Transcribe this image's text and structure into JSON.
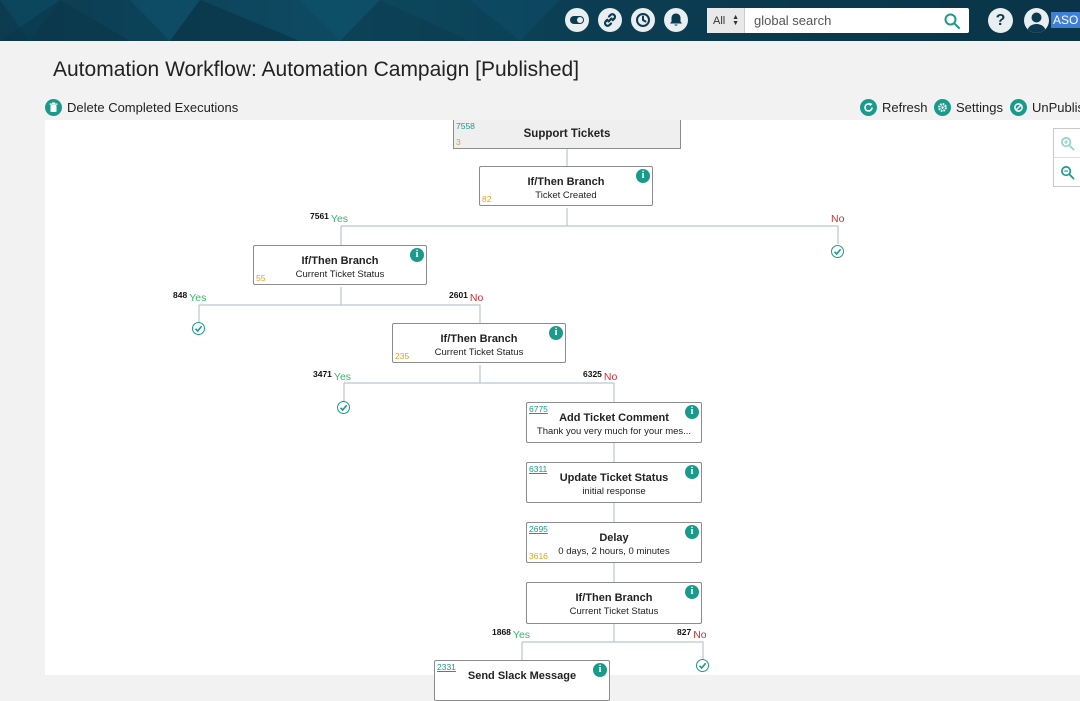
{
  "topbar": {
    "icons": [
      "toggle-icon",
      "link-icon",
      "history-icon",
      "bell-icon"
    ],
    "search": {
      "scope": "All",
      "placeholder": "global search"
    },
    "help": "?",
    "user_name": "ASO I"
  },
  "header": {
    "title": "Automation Workflow: Automation Campaign [Published]",
    "delete_label": "Delete Completed Executions",
    "refresh_label": "Refresh",
    "settings_label": "Settings",
    "unpublish_label": "UnPublis"
  },
  "workflow": {
    "trigger": {
      "title": "Support Tickets",
      "count_top": "7558",
      "count_bottom": "3"
    },
    "nodes": [
      {
        "title": "If/Then Branch",
        "subtitle": "Ticket Created",
        "count_top": "",
        "count_bottom": "82"
      },
      {
        "title": "If/Then Branch",
        "subtitle": "Current Ticket Status",
        "count_top": "",
        "count_bottom": "55"
      },
      {
        "title": "If/Then Branch",
        "subtitle": "Current Ticket Status",
        "count_top": "",
        "count_bottom": "235"
      },
      {
        "title": "Add Ticket Comment",
        "subtitle": "Thank you very much for your mes...",
        "count_top": "6775",
        "count_bottom": ""
      },
      {
        "title": "Update Ticket Status",
        "subtitle": "initial response",
        "count_top": "6311",
        "count_bottom": ""
      },
      {
        "title": "Delay",
        "subtitle": "0 days, 2 hours, 0 minutes",
        "count_top": "2695",
        "count_bottom": "3616"
      },
      {
        "title": "If/Then Branch",
        "subtitle": "Current Ticket Status",
        "count_top": "",
        "count_bottom": ""
      },
      {
        "title": "Send Slack Message",
        "subtitle": "",
        "count_top": "2331",
        "count_bottom": ""
      }
    ],
    "branches": [
      {
        "count": "7561",
        "label": "Yes"
      },
      {
        "count": "",
        "label": "No"
      },
      {
        "count": "848",
        "label": "Yes"
      },
      {
        "count": "2601",
        "label": "No"
      },
      {
        "count": "3471",
        "label": "Yes"
      },
      {
        "count": "6325",
        "label": "No"
      },
      {
        "count": "1868",
        "label": "Yes"
      },
      {
        "count": "827",
        "label": "No"
      }
    ]
  },
  "colors": {
    "accent": "#1a9a8a",
    "yes": "#39b56b",
    "no": "#d22d2d",
    "queued": "#e3a11b",
    "topbar": "#0c3b50"
  }
}
